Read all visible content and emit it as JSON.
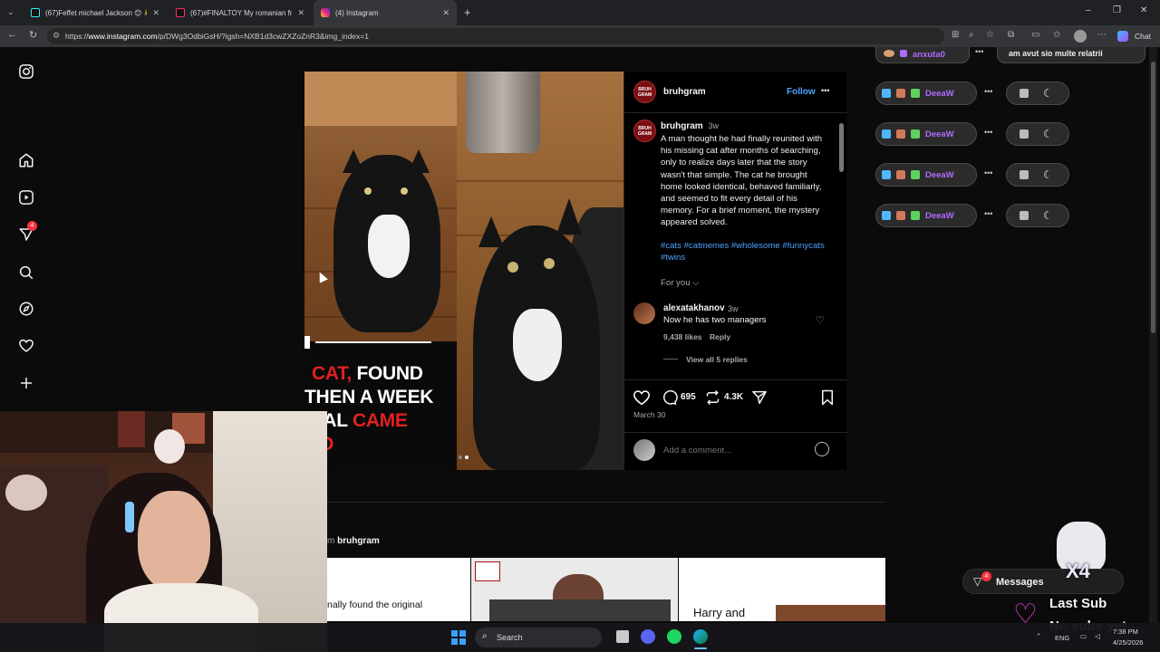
{
  "browser": {
    "tabs": [
      {
        "title": "(67)Feffet michael Jackson 😊 👋 💃",
        "active": false,
        "favicon": "tiktok-icon"
      },
      {
        "title": "(67)#FINALTOY My romanian frien",
        "active": false,
        "favicon": "tiktok-icon"
      },
      {
        "title": "(4) Instagram",
        "active": true,
        "favicon": "instagram-icon"
      }
    ],
    "new_tab": "+",
    "url": "https://www.instagram.com/p/DWg3OdbiGsH/?igsh=NXB1d3cwZXZoZnR3&img_index=1",
    "url_prefix": "https://",
    "url_host": "www.instagram.com",
    "url_rest": "/p/DWg3OdbiGsH/?igsh=NXB1d3cwZXZoZnR3&img_index=1",
    "chat_label": "Chat",
    "window_controls": [
      "–",
      "❐",
      "✕"
    ]
  },
  "sidebar": {
    "notifications_badge": "4",
    "items": [
      "instagram-logo",
      "home-icon",
      "reels-icon",
      "messages-icon",
      "search-icon",
      "explore-icon",
      "heart-icon",
      "create-icon"
    ]
  },
  "post": {
    "overlay_lines": [
      {
        "white": "",
        "red": "CAT,",
        "white2": " FOUND"
      },
      {
        "white": "THEN A WEEK",
        "red": "",
        "white2": ""
      },
      {
        "white": "INAL ",
        "red": "CAME",
        "white2": ""
      },
      {
        "white": "",
        "red": "OO",
        "white2": ""
      }
    ],
    "author": "bruhgram",
    "follow_label": "Follow",
    "more_label": "•••",
    "caption_time": "3w",
    "caption": "A man thought he had finally reunited with his missing cat after months of searching, only to realize days later that the story wasn't that simple. The cat he brought home looked identical, behaved familiarly, and seemed to fit every detail of his memory. For a brief moment, the mystery appeared solved.",
    "hashtags": "#cats #catmemes #wholesome #funnycats #twins",
    "for_you": "For you",
    "comment": {
      "author": "alexatakhanov",
      "time": "3w",
      "text": "Now he has two managers",
      "likes": "9,438 likes",
      "reply": "Reply",
      "view_replies": "View all 5 replies"
    },
    "comment_count": "695",
    "share_count": "4.3K",
    "date": "March 30",
    "add_comment_placeholder": "Add a comment...",
    "avatar_text": "BRUH GRAM"
  },
  "related": {
    "label_prefix": "m ",
    "label_author": "bruhgram",
    "thumb1_text": "nally found the original",
    "thumb3_text": "Harry and"
  },
  "chat_overlay": {
    "top_user": "anxuta0",
    "top_message": "am avut sio multe relatrii",
    "rows": [
      {
        "user": "DeeaW",
        "dots": "•••"
      },
      {
        "user": "DeeaW",
        "dots": "•••"
      },
      {
        "user": "DeeaW",
        "dots": "•••"
      },
      {
        "user": "DeeaW",
        "dots": "•••"
      }
    ]
  },
  "stream": {
    "messages_label": "Messages",
    "messages_badge": "4",
    "multiplier": "X4",
    "last_sub": "Last Sub",
    "no_subs": "No subs yet"
  },
  "taskbar": {
    "search_label": "Search",
    "lang": "ENG",
    "time": "7:38 PM",
    "date": "4/25/2026"
  },
  "colors": {
    "accent": "#4da3ff",
    "badge": "#ff3040",
    "chat_purple": "#b06bff",
    "heart_magenta": "#e03fd6"
  }
}
